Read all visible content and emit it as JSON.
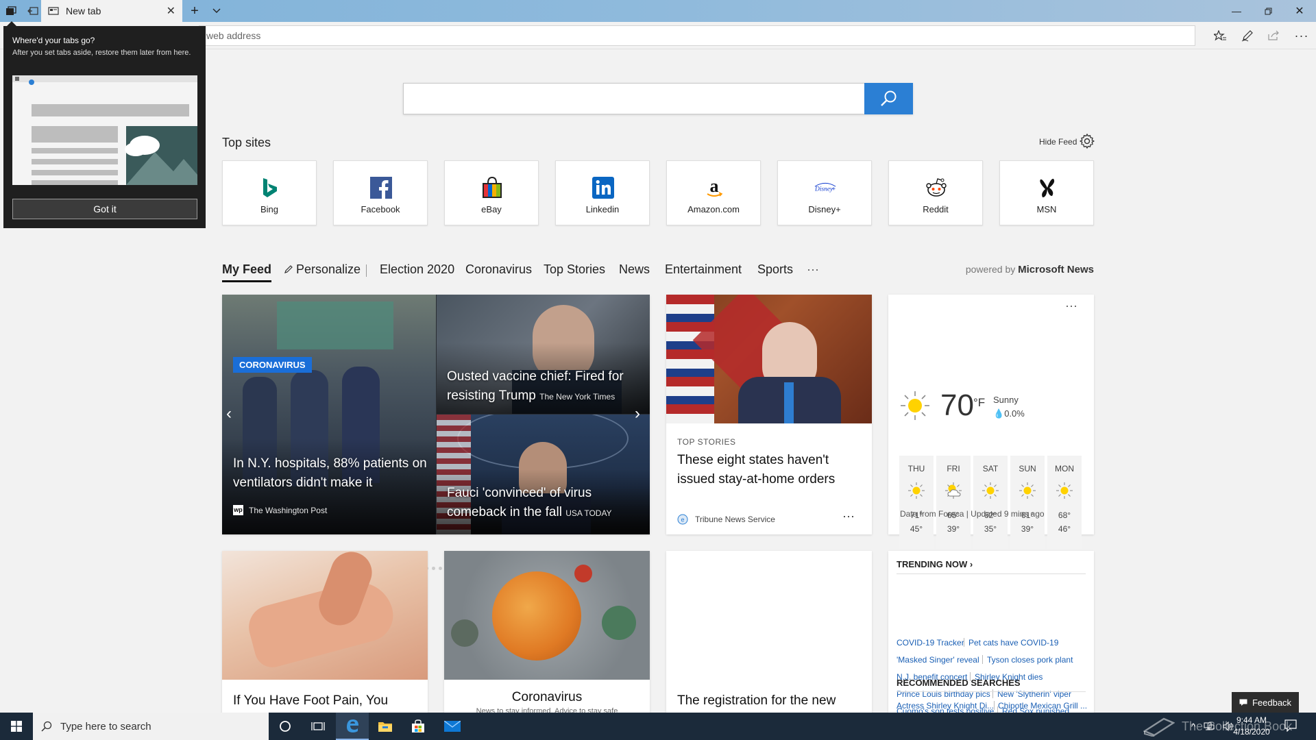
{
  "browser": {
    "tab_title": "New tab",
    "address_placeholder": "web address"
  },
  "search": {
    "placeholder": ""
  },
  "top_sites": {
    "title": "Top sites",
    "hide_feed": "Hide Feed",
    "sites": [
      {
        "label": "Bing",
        "icon": "bing-icon",
        "color": "#008373"
      },
      {
        "label": "Facebook",
        "icon": "facebook-icon",
        "color": "#3b5998"
      },
      {
        "label": "eBay",
        "icon": "ebay-icon",
        "color": "#e53238"
      },
      {
        "label": "Linkedin",
        "icon": "linkedin-icon",
        "color": "#0a66c2"
      },
      {
        "label": "Amazon.com",
        "icon": "amazon-icon",
        "color": "#111111"
      },
      {
        "label": "Disney+",
        "icon": "disney-plus-icon",
        "color": "#113ccf"
      },
      {
        "label": "Reddit",
        "icon": "reddit-icon",
        "color": "#ff4500"
      },
      {
        "label": "MSN",
        "icon": "msn-icon",
        "color": "#111111"
      }
    ]
  },
  "feed_tabs": {
    "items": [
      "My Feed",
      "Personalize",
      "Election 2020",
      "Coronavirus",
      "Top Stories",
      "News",
      "Entertainment",
      "Sports",
      "···"
    ],
    "powered_prefix": "powered by",
    "powered_brand": "Microsoft News"
  },
  "hero": {
    "chip": "CORONAVIRUS",
    "left_title": "In N.Y. hospitals, 88% patients on ventilators didn't make it",
    "left_source": "The Washington Post",
    "right_top_title": "Ousted vaccine chief: Fired for resisting Trump",
    "right_top_source": "The New York Times",
    "right_bottom_title": "Fauci 'convinced' of virus comeback in the fall",
    "right_bottom_source": "USA TODAY",
    "dot_count": 33,
    "active_dot": 0
  },
  "story": {
    "category": "TOP STORIES",
    "headline": "These eight states haven't issued stay-at-home orders",
    "source": "Tribune News Service"
  },
  "weather": {
    "temp": "70",
    "unit": "°F",
    "condition": "Sunny",
    "precip": "0.0%",
    "days": [
      {
        "day": "THU",
        "hi": "71°",
        "lo": "45°",
        "icon": "sun-icon"
      },
      {
        "day": "FRI",
        "hi": "65°",
        "lo": "39°",
        "icon": "partly-cloudy-icon"
      },
      {
        "day": "SAT",
        "hi": "62°",
        "lo": "35°",
        "icon": "sun-icon"
      },
      {
        "day": "SUN",
        "hi": "61°",
        "lo": "39°",
        "icon": "sun-icon"
      },
      {
        "day": "MON",
        "hi": "68°",
        "lo": "46°",
        "icon": "sun-icon"
      }
    ],
    "footer": "Data from Foreca | Updated 9 mins ago"
  },
  "row2": {
    "foot_title": "If You Have Foot Pain, You",
    "corona_title": "Coronavirus",
    "corona_sub": "News to stay informed. Advice to stay safe",
    "registration_title": "The registration for the new"
  },
  "trending": {
    "title": "TRENDING NOW ›",
    "links": [
      [
        "COVID-19 Tracker",
        "Pet cats have COVID-19"
      ],
      [
        "'Masked Singer' reveal",
        "Tyson closes pork plant"
      ],
      [
        "N.J. benefit concert",
        "Shirley Knight dies"
      ],
      [
        "Prince Louis birthday pics",
        "New 'Slytherin' viper"
      ],
      [
        "Cuomo's son tests positive",
        "Red Sox punished"
      ]
    ],
    "recommended_title": "RECOMMENDED SEARCHES",
    "recommended": [
      "Actress Shirley Knight Di...",
      "Chipotle Mexican Grill ..."
    ]
  },
  "popup": {
    "title": "Where'd your tabs go?",
    "desc": "After you set tabs aside, restore them later from here.",
    "button": "Got it"
  },
  "feedback": "Feedback",
  "taskbar": {
    "search_placeholder": "Type here to search",
    "time": "9:44 AM",
    "date": "4/18/2020",
    "watermark": "The Collection Book"
  }
}
